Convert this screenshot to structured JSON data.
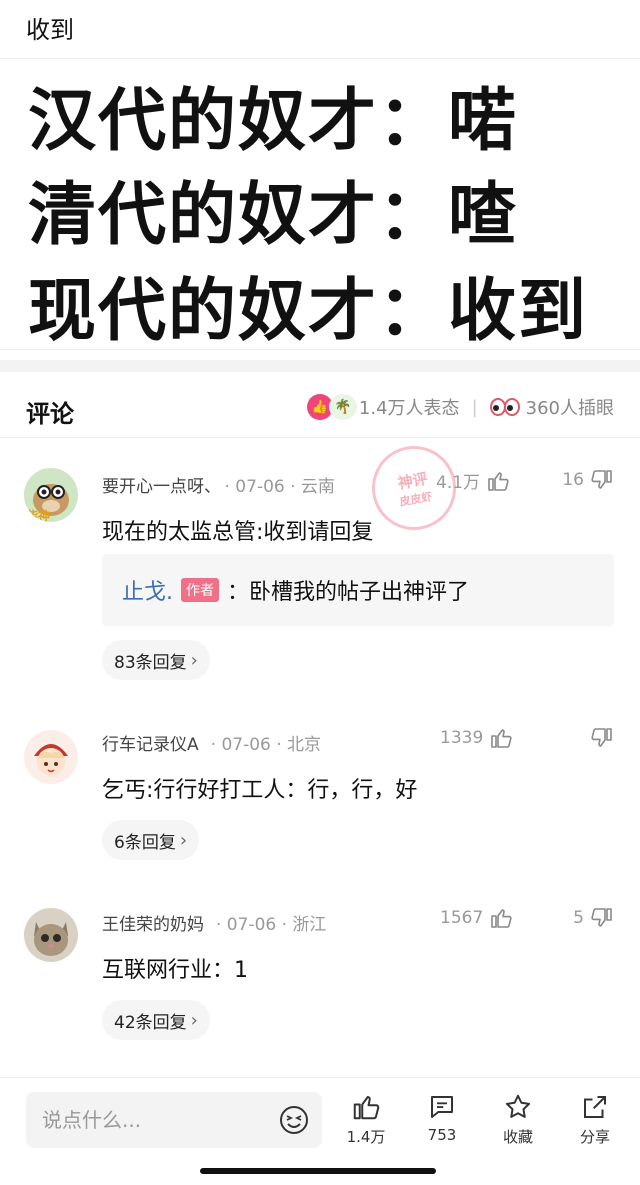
{
  "post": {
    "title": "收到"
  },
  "meme": {
    "line1": "汉代的奴才：喏",
    "line2": "清代的奴才：喳",
    "line3": "现代的奴才：收到"
  },
  "comments_header": {
    "title": "评论",
    "reactions_label": "1.4万人表态",
    "side_eye_label": "360人插眼"
  },
  "stamp": {
    "line1": "神评",
    "line2": "皮皮虾"
  },
  "comments": [
    {
      "name": "要开心一点呀、",
      "date": "· 07-06 · 云南",
      "likes": "4.1万",
      "dislikes": "16",
      "text": "现在的太监总管:收到请回复",
      "sub_reply": {
        "name": "止戈.",
        "badge": "作者",
        "text": "：卧槽我的帖子出神评了"
      },
      "replies": "83条回复"
    },
    {
      "name": "行车记录仪A",
      "date": "· 07-06 · 北京",
      "likes": "1339",
      "dislikes": "",
      "text": "乞丐:行行好打工人：行，行，好",
      "replies": "6条回复"
    },
    {
      "name": "王佳荣的奶妈",
      "date": "· 07-06 · 浙江",
      "likes": "1567",
      "dislikes": "5",
      "text": "互联网行业：1",
      "replies": "42条回复"
    }
  ],
  "bottom_bar": {
    "input_placeholder": "说点什么...",
    "like_count": "1.4万",
    "comment_count": "753",
    "favorite_label": "收藏",
    "share_label": "分享"
  },
  "colors": {
    "accent_pink": "#f0457a",
    "link_blue": "#3a6fb5",
    "badge_pink": "#f0708a"
  }
}
